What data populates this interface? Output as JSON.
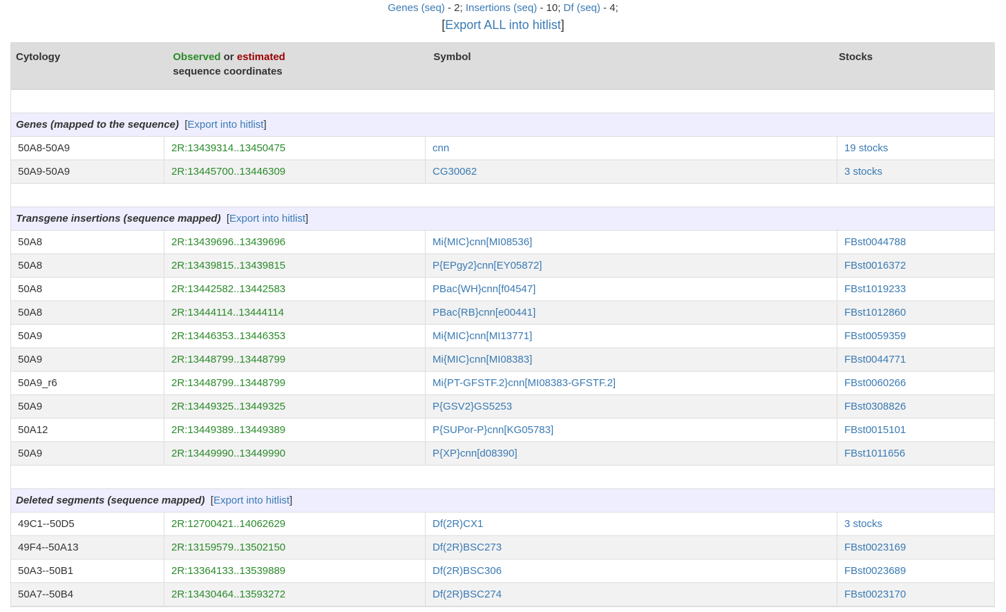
{
  "summary": {
    "genes_label": "Genes (seq)",
    "genes_count": " - 2; ",
    "insertions_label": "Insertions (seq)",
    "insertions_count": " - 10; ",
    "df_label": "Df (seq)",
    "df_count": " - 4;"
  },
  "export_all": {
    "open": "[",
    "label": "Export ALL into hitlist",
    "close": "]"
  },
  "table": {
    "headers": {
      "cytology": "Cytology",
      "observed": "Observed",
      "or": " or ",
      "estimated": "estimated",
      "seq_coords": "sequence coordinates",
      "symbol": "Symbol",
      "stocks": "Stocks"
    },
    "export_label": "Export into hitlist",
    "sections": [
      {
        "title": "Genes (mapped to the sequence)",
        "rows": [
          {
            "cytology": "50A8-50A9",
            "coords": "2R:13439314..13450475",
            "symbol": "cnn",
            "stocks": "19 stocks"
          },
          {
            "cytology": "50A9-50A9",
            "coords": "2R:13445700..13446309",
            "symbol": "CG30062",
            "stocks": "3 stocks"
          }
        ]
      },
      {
        "title": "Transgene insertions (sequence mapped)",
        "rows": [
          {
            "cytology": "50A8",
            "coords": "2R:13439696..13439696",
            "symbol": "Mi{MIC}cnn[MI08536]",
            "stocks": "FBst0044788"
          },
          {
            "cytology": "50A8",
            "coords": "2R:13439815..13439815",
            "symbol": "P{EPgy2}cnn[EY05872]",
            "stocks": "FBst0016372"
          },
          {
            "cytology": "50A8",
            "coords": "2R:13442582..13442583",
            "symbol": "PBac{WH}cnn[f04547]",
            "stocks": "FBst1019233"
          },
          {
            "cytology": "50A8",
            "coords": "2R:13444114..13444114",
            "symbol": "PBac{RB}cnn[e00441]",
            "stocks": "FBst1012860"
          },
          {
            "cytology": "50A9",
            "coords": "2R:13446353..13446353",
            "symbol": "Mi{MIC}cnn[MI13771]",
            "stocks": "FBst0059359"
          },
          {
            "cytology": "50A9",
            "coords": "2R:13448799..13448799",
            "symbol": "Mi{MIC}cnn[MI08383]",
            "stocks": "FBst0044771"
          },
          {
            "cytology": "50A9_r6",
            "coords": "2R:13448799..13448799",
            "symbol": "Mi{PT-GFSTF.2}cnn[MI08383-GFSTF.2]",
            "stocks": "FBst0060266"
          },
          {
            "cytology": "50A9",
            "coords": "2R:13449325..13449325",
            "symbol": "P{GSV2}GS5253",
            "stocks": "FBst0308826"
          },
          {
            "cytology": "50A12",
            "coords": "2R:13449389..13449389",
            "symbol": "P{SUPor-P}cnn[KG05783]",
            "stocks": "FBst0015101"
          },
          {
            "cytology": "50A9",
            "coords": "2R:13449990..13449990",
            "symbol": "P{XP}cnn[d08390]",
            "stocks": "FBst1011656"
          }
        ]
      },
      {
        "title": "Deleted segments (sequence mapped)",
        "rows": [
          {
            "cytology": "49C1--50D5",
            "coords": "2R:12700421..14062629",
            "symbol": "Df(2R)CX1",
            "stocks": "3 stocks"
          },
          {
            "cytology": "49F4--50A13",
            "coords": "2R:13159579..13502150",
            "symbol": "Df(2R)BSC273",
            "stocks": "FBst0023169"
          },
          {
            "cytology": "50A3--50B1",
            "coords": "2R:13364133..13539889",
            "symbol": "Df(2R)BSC306",
            "stocks": "FBst0023689"
          },
          {
            "cytology": "50A7--50B4",
            "coords": "2R:13430464..13593272",
            "symbol": "Df(2R)BSC274",
            "stocks": "FBst0023170"
          }
        ]
      }
    ]
  }
}
